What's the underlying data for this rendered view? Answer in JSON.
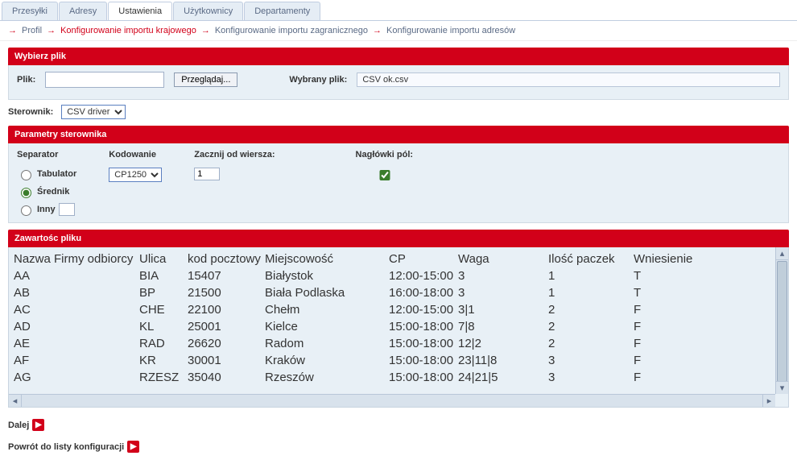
{
  "tabs": [
    "Przesyłki",
    "Adresy",
    "Ustawienia",
    "Użytkownicy",
    "Departamenty"
  ],
  "breadcrumbs": [
    "Profil",
    "Konfigurowanie importu krajowego",
    "Konfigurowanie importu zagranicznego",
    "Konfigurowanie importu adresów"
  ],
  "panel1": {
    "title": "Wybierz plik",
    "file_label": "Plik:",
    "browse": "Przeglądaj...",
    "selected_label": "Wybrany plik:",
    "selected_value": "CSV ok.csv"
  },
  "driver": {
    "label": "Sterownik:",
    "value": "CSV driver"
  },
  "panel2": {
    "title": "Parametry sterownika",
    "separator": {
      "label": "Separator",
      "opt1": "Tabulator",
      "opt2": "Średnik",
      "opt3": "Inny"
    },
    "encoding": {
      "label": "Kodowanie",
      "value": "CP1250"
    },
    "startrow": {
      "label": "Zacznij od wiersza:",
      "value": "1"
    },
    "headers": {
      "label": "Nagłówki pól:"
    }
  },
  "panel3": {
    "title": "Zawartośc pliku"
  },
  "chart_data": {
    "type": "table",
    "columns": [
      "Nazwa Firmy odbiorcy",
      "Ulica",
      "kod pocztowy",
      "Miejscowość",
      "CP",
      "Waga",
      "Ilość paczek",
      "Wniesienie"
    ],
    "rows": [
      [
        "AA",
        "BIA",
        "15407",
        "Białystok",
        "12:00-15:00",
        "3",
        "1",
        "T"
      ],
      [
        "AB",
        "BP",
        "21500",
        "Biała Podlaska",
        "16:00-18:00",
        "3",
        "1",
        "T"
      ],
      [
        "AC",
        "CHE",
        "22100",
        "Chełm",
        "12:00-15:00",
        "3|1",
        "2",
        "F"
      ],
      [
        "AD",
        "KL",
        "25001",
        "Kielce",
        "15:00-18:00",
        "7|8",
        "2",
        "F"
      ],
      [
        "AE",
        "RAD",
        "26620",
        "Radom",
        "15:00-18:00",
        "12|2",
        "2",
        "F"
      ],
      [
        "AF",
        "KR",
        "30001",
        "Kraków",
        "15:00-18:00",
        "23|11|8",
        "3",
        "F"
      ],
      [
        "AG",
        "RZESZ",
        "35040",
        "Rzeszów",
        "15:00-18:00",
        "24|21|5",
        "3",
        "F"
      ]
    ]
  },
  "footer": {
    "next": "Dalej",
    "back": "Powrót do listy konfiguracji"
  }
}
